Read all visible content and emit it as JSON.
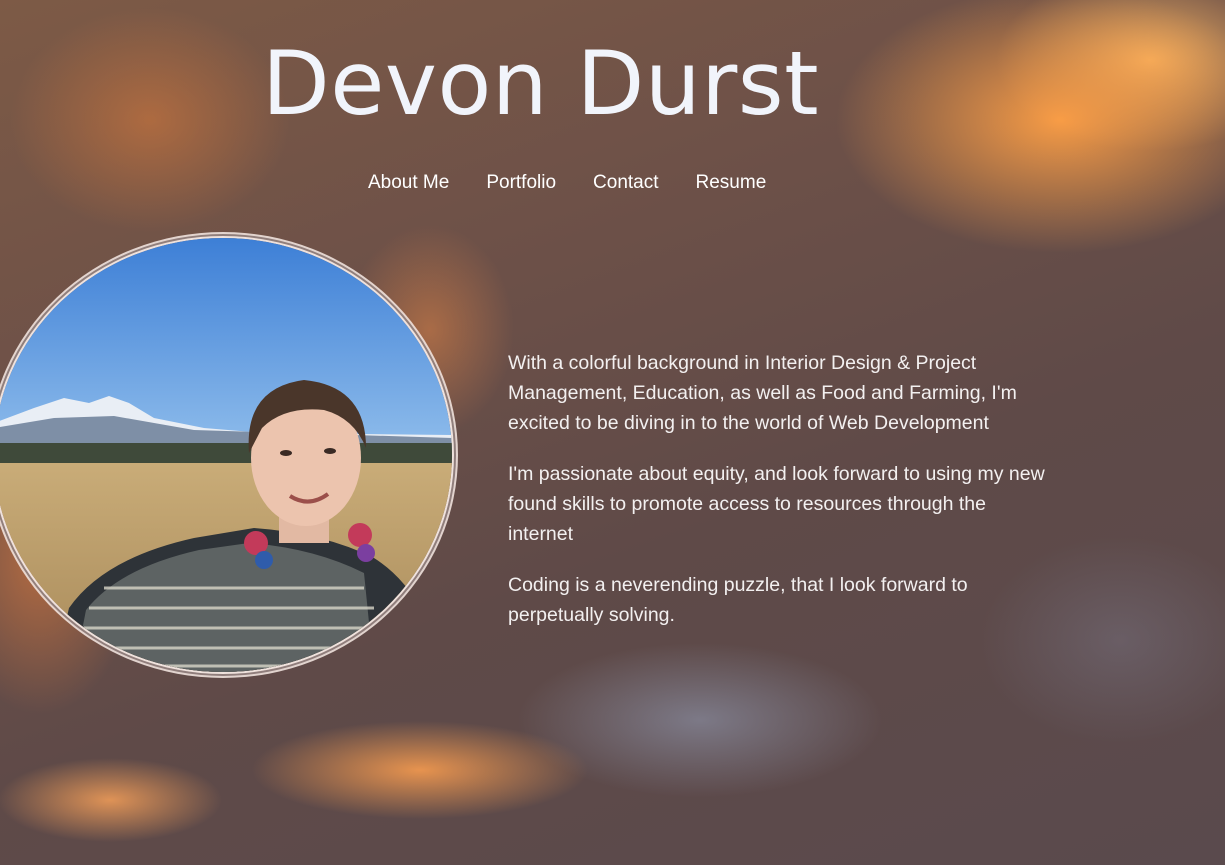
{
  "site": {
    "title": "Devon Durst"
  },
  "nav": {
    "items": [
      {
        "label": "About Me"
      },
      {
        "label": "Portfolio"
      },
      {
        "label": "Contact"
      },
      {
        "label": "Resume"
      }
    ]
  },
  "bio": {
    "paragraphs": [
      "With a colorful background in Interior Design & Project Management, Education, as well as Food and Farming, I'm excited to be diving in to the world of Web Development",
      "I'm passionate about equity, and look forward to using my new found skills to promote access to resources through the internet",
      "Coding is a neverending puzzle, that I look forward to perpetually solving."
    ]
  },
  "colors": {
    "title": "#f1f4fb",
    "nav_text": "#ffffff",
    "body_text": "#f3f0f0",
    "portrait_border": "#efe2dd"
  }
}
